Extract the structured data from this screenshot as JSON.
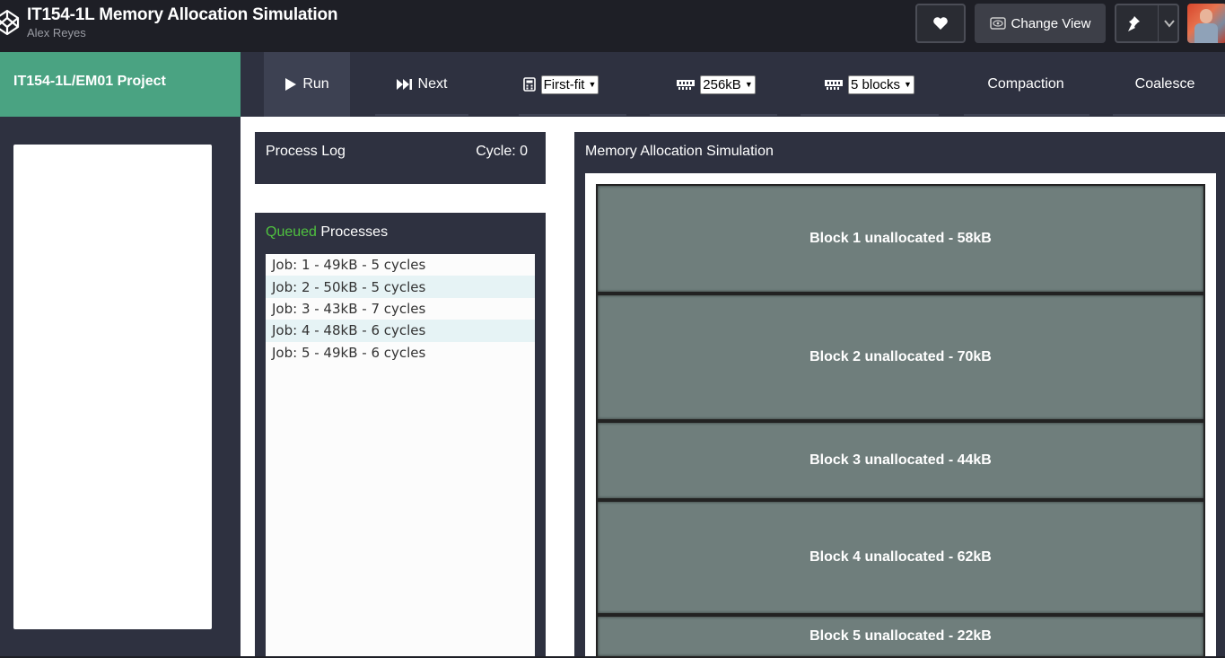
{
  "header": {
    "title": "IT154-1L Memory Allocation Simulation",
    "author": "Alex Reyes",
    "change_view_label": "Change View",
    "icons": [
      "codepen-logo-icon",
      "heart-icon",
      "eye-icon",
      "pin-icon",
      "chevron-down-icon"
    ]
  },
  "toolbar": {
    "project_label": "IT154-1L/EM01 Project",
    "run_label": "Run",
    "next_label": "Next",
    "fit_value": "First-fit",
    "memory_value": "256kB",
    "blocks_value": "5 blocks",
    "compaction_label": "Compaction",
    "coalesce_label": "Coalesce"
  },
  "process_log": {
    "title": "Process Log",
    "cycle_label": "Cycle: 0"
  },
  "queue": {
    "title_highlight": "Queued",
    "title_rest": " Processes",
    "jobs": [
      "Job: 1 - 49kB - 5 cycles",
      "Job: 2 - 50kB - 5 cycles",
      "Job: 3 - 43kB - 7 cycles",
      "Job: 4 - 48kB - 6 cycles",
      "Job: 5 - 49kB - 6 cycles"
    ]
  },
  "memory": {
    "title": "Memory Allocation Simulation",
    "blocks": [
      "Block 1 unallocated - 58kB",
      "Block 2 unallocated - 70kB",
      "Block 3 unallocated - 44kB",
      "Block 4 unallocated - 62kB",
      "Block 5 unallocated - 22kB"
    ]
  },
  "colors": {
    "project_bg": "#4aa382",
    "queued_text": "#4fc13f",
    "panel_bg": "#2e3140",
    "block_bg": "#6f7e7c"
  }
}
